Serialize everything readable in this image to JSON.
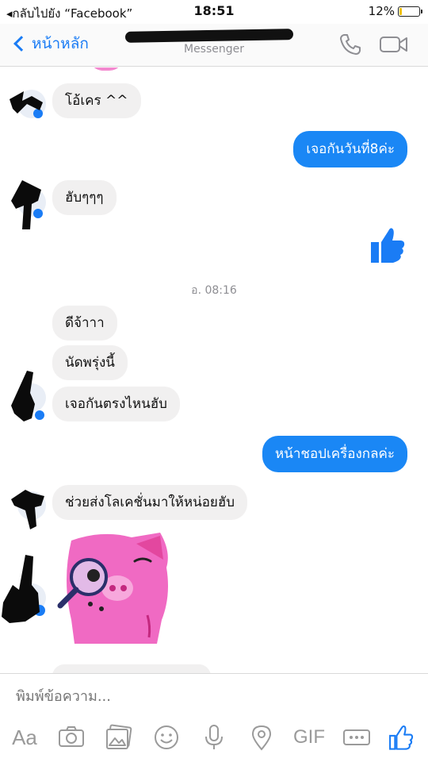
{
  "status_bar": {
    "back_app": "◂กลับไปยัง “Facebook”",
    "time": "18:51",
    "battery": "12%",
    "battery_level": 0.12
  },
  "nav": {
    "back_label": "หน้าหลัก",
    "subtitle": "Messenger"
  },
  "colors": {
    "accent": "#1a87f5",
    "incoming_bubble": "#f1f0f0",
    "sticker_pink": "#f06ac3"
  },
  "messages": {
    "m1": "โอ้เคร ^^",
    "m2": "เจอกันวันที่8ค่ะ",
    "m3": "ฮับๆๆๆ",
    "timestamp": "อ. 08:16",
    "m4": "ดีจ้าาา",
    "m5": "นัดพรุ่งนี้",
    "m6": "เจอกันตรงไหนฮับ",
    "m7": "หน้าชอปเครื่องกลค่ะ",
    "m8": "ช่วยส่งโลเคชั่นมาให้หน่อยฮับ"
  },
  "composer": {
    "placeholder": "พิมพ์ข้อความ...",
    "text_tool": "Aa",
    "gif_tool": "GIF"
  },
  "icons": [
    "phone-icon",
    "video-camera-icon",
    "like-thumb-icon",
    "camera-icon",
    "gallery-icon",
    "emoji-icon",
    "microphone-icon",
    "location-pin-icon",
    "more-icon",
    "search-pig-sticker"
  ]
}
